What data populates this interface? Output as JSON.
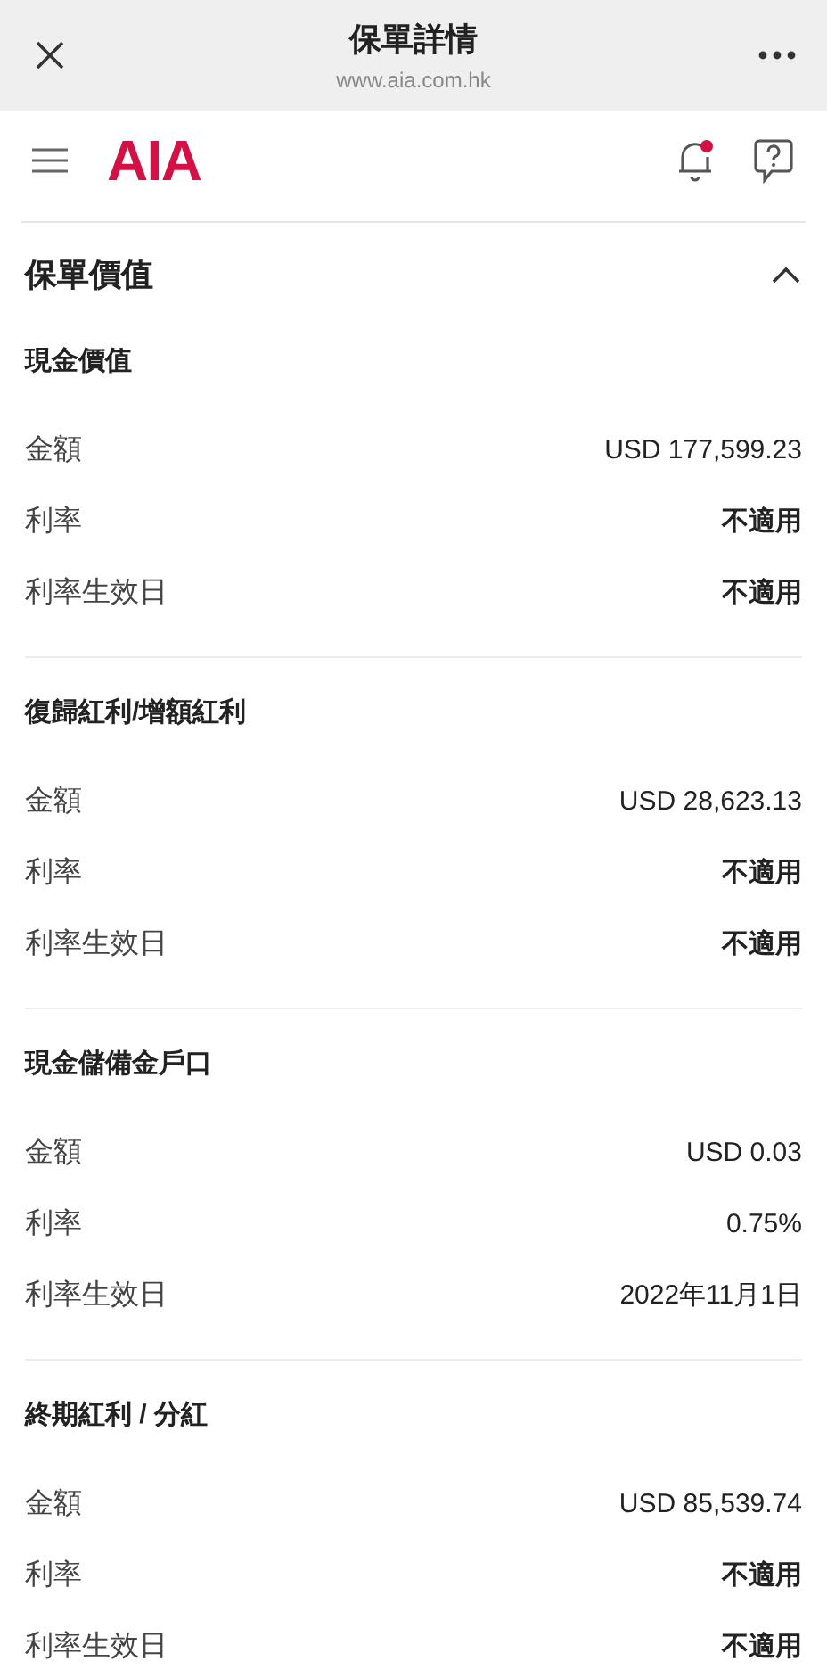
{
  "browser": {
    "title": "保單詳情",
    "url": "www.aia.com.hk"
  },
  "app_header": {
    "logo": "AIA",
    "notification_unread": true
  },
  "section": {
    "title": "保單價值",
    "expanded": true,
    "groups": [
      {
        "title": "現金價值",
        "rows": [
          {
            "label": "金額",
            "value": "USD 177,599.23",
            "bold": false
          },
          {
            "label": "利率",
            "value": "不適用",
            "bold": true
          },
          {
            "label": "利率生效日",
            "value": "不適用",
            "bold": true
          }
        ]
      },
      {
        "title": "復歸紅利/增額紅利",
        "rows": [
          {
            "label": "金額",
            "value": "USD 28,623.13",
            "bold": false
          },
          {
            "label": "利率",
            "value": "不適用",
            "bold": true
          },
          {
            "label": "利率生效日",
            "value": "不適用",
            "bold": true
          }
        ]
      },
      {
        "title": "現金儲備金戶口",
        "rows": [
          {
            "label": "金額",
            "value": "USD 0.03",
            "bold": false
          },
          {
            "label": "利率",
            "value": "0.75%",
            "bold": false
          },
          {
            "label": "利率生效日",
            "value": "2022年11月1日",
            "bold": false
          }
        ]
      },
      {
        "title": "終期紅利 / 分紅",
        "rows": [
          {
            "label": "金額",
            "value": "USD 85,539.74",
            "bold": false
          },
          {
            "label": "利率",
            "value": "不適用",
            "bold": true
          },
          {
            "label": "利率生效日",
            "value": "不適用",
            "bold": true
          }
        ]
      }
    ]
  }
}
